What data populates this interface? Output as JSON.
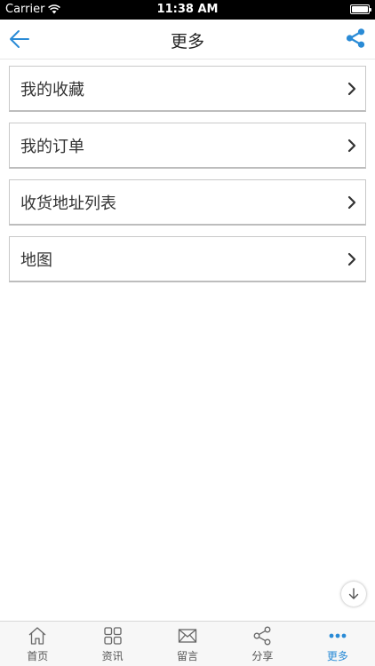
{
  "status_bar": {
    "carrier": "Carrier",
    "time": "11:38 AM"
  },
  "nav": {
    "title": "更多",
    "accent_color": "#2a8bd6"
  },
  "menu": {
    "items": [
      {
        "label": "我的收藏"
      },
      {
        "label": "我的订单"
      },
      {
        "label": "收货地址列表"
      },
      {
        "label": "地图"
      }
    ]
  },
  "tabs": [
    {
      "label": "首页",
      "icon": "home-icon"
    },
    {
      "label": "资讯",
      "icon": "grid-icon"
    },
    {
      "label": "留言",
      "icon": "mail-icon"
    },
    {
      "label": "分享",
      "icon": "share-icon"
    },
    {
      "label": "更多",
      "icon": "more-icon",
      "active": true
    }
  ]
}
